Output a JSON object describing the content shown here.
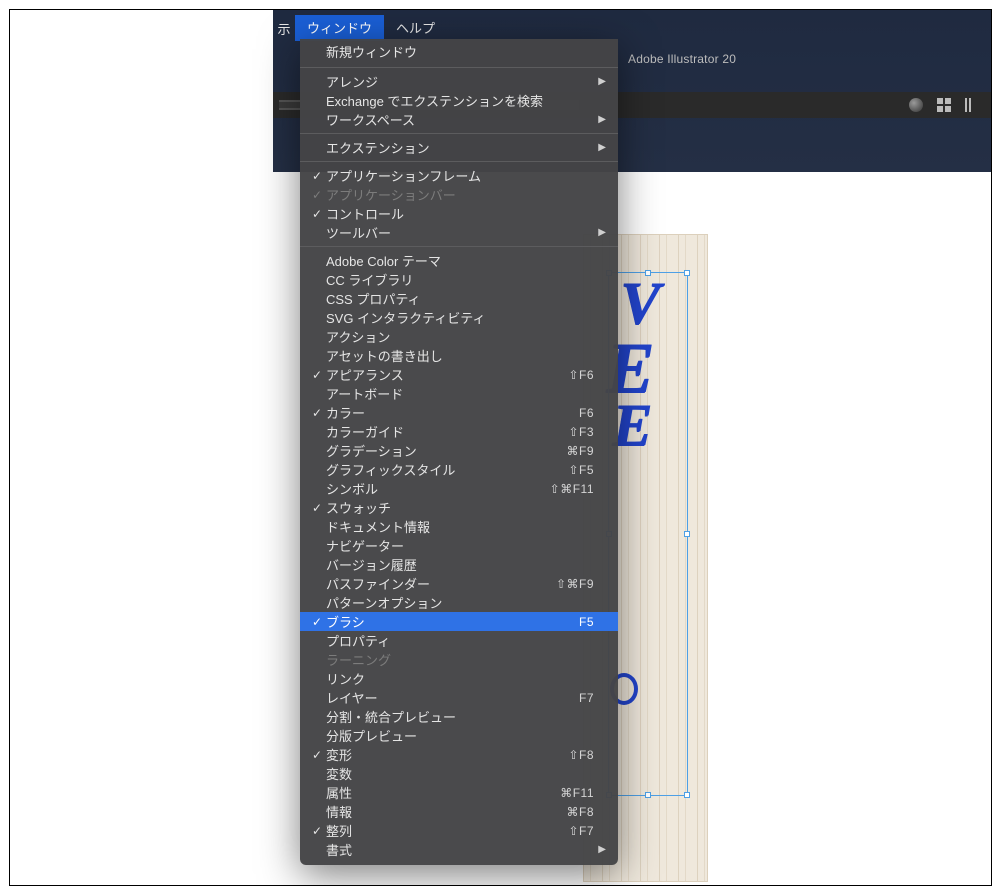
{
  "menubar": {
    "stub": "示",
    "window": "ウィンドウ",
    "help": "ヘルプ"
  },
  "topbar": {
    "title_fragment": "Adobe Illustrator 20"
  },
  "canvas": {
    "letter1": "V",
    "letter2": "E",
    "letter3": "E"
  },
  "menu": {
    "new_window": "新規ウィンドウ",
    "arrange": "アレンジ",
    "exchange": "Exchange でエクステンションを検索...",
    "workspace": "ワークスペース",
    "extension": "エクステンション",
    "app_frame": "アプリケーションフレーム",
    "app_bar": "アプリケーションバー",
    "control": "コントロール",
    "toolbar": "ツールバー",
    "adobe_color": "Adobe Color テーマ",
    "cc_lib": "CC ライブラリ",
    "css_prop": "CSS プロパティ",
    "svg_inter": "SVG インタラクティビティ",
    "action": "アクション",
    "asset_export": "アセットの書き出し",
    "appearance": "アピアランス",
    "artboard": "アートボード",
    "color": "カラー",
    "color_guide": "カラーガイド",
    "gradient": "グラデーション",
    "graphic_style": "グラフィックスタイル",
    "symbol": "シンボル",
    "swatch": "スウォッチ",
    "doc_info": "ドキュメント情報",
    "navigator": "ナビゲーター",
    "version_hist": "バージョン履歴",
    "pathfinder": "パスファインダー",
    "pattern_opt": "パターンオプション",
    "brush": "ブラシ",
    "property": "プロパティ",
    "learning": "ラーニング",
    "link": "リンク",
    "layer": "レイヤー",
    "flatten_prev": "分割・統合プレビュー",
    "sep_prev": "分版プレビュー",
    "transform": "変形",
    "variable": "変数",
    "attribute": "属性",
    "info": "情報",
    "align": "整列",
    "type": "書式"
  },
  "shortcut": {
    "appearance": "⇧F6",
    "color": "F6",
    "color_guide": "⇧F3",
    "gradient": "⌘F9",
    "graphic_style": "⇧F5",
    "symbol": "⇧⌘F11",
    "pathfinder": "⇧⌘F9",
    "brush": "F5",
    "layer": "F7",
    "transform": "⇧F8",
    "attribute": "⌘F11",
    "info": "⌘F8",
    "align": "⇧F7"
  }
}
